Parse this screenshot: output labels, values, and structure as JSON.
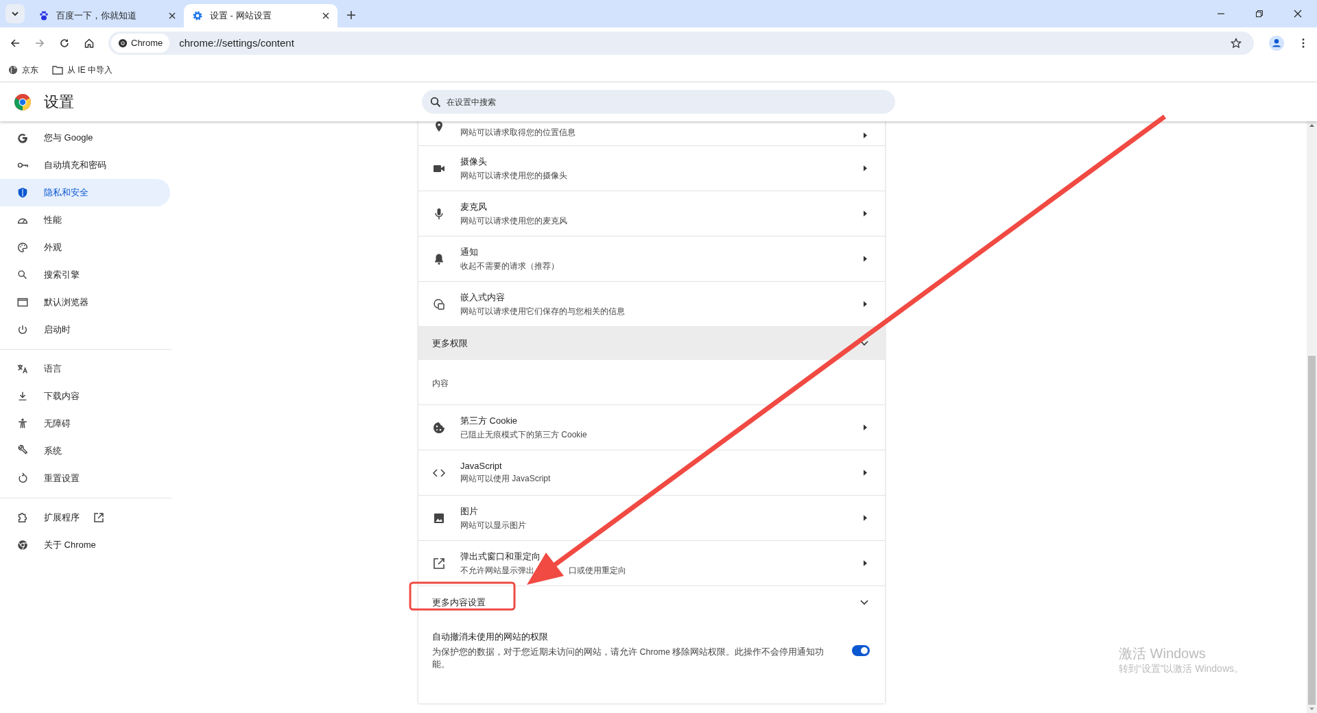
{
  "tabs": [
    {
      "title": "百度一下，你就知道",
      "kind": "paw",
      "selected": false
    },
    {
      "title": "设置 - 网站设置",
      "kind": "gear",
      "selected": true
    }
  ],
  "address_bar": {
    "chip": "Chrome",
    "url": "chrome://settings/content"
  },
  "bookmarks": [
    {
      "label": "京东",
      "kind": "globe"
    },
    {
      "label": "从 IE 中导入",
      "kind": "folder"
    }
  ],
  "header": {
    "title": "设置",
    "search_placeholder": "在设置中搜索"
  },
  "sidebar": {
    "groups": [
      [
        {
          "label": "您与 Google",
          "kind": "google",
          "selected": false,
          "external": false
        },
        {
          "label": "自动填充和密码",
          "kind": "key",
          "selected": false,
          "external": false
        },
        {
          "label": "隐私和安全",
          "kind": "shield",
          "selected": true,
          "external": false
        },
        {
          "label": "性能",
          "kind": "gauge",
          "selected": false,
          "external": false
        },
        {
          "label": "外观",
          "kind": "palette",
          "selected": false,
          "external": false
        },
        {
          "label": "搜索引擎",
          "kind": "search",
          "selected": false,
          "external": false
        },
        {
          "label": "默认浏览器",
          "kind": "window",
          "selected": false,
          "external": false
        },
        {
          "label": "启动时",
          "kind": "power",
          "selected": false,
          "external": false
        }
      ],
      [
        {
          "label": "语言",
          "kind": "translate",
          "selected": false,
          "external": false
        },
        {
          "label": "下载内容",
          "kind": "download",
          "selected": false,
          "external": false
        },
        {
          "label": "无障碍",
          "kind": "person",
          "selected": false,
          "external": false
        },
        {
          "label": "系统",
          "kind": "wrench",
          "selected": false,
          "external": false
        },
        {
          "label": "重置设置",
          "kind": "reset",
          "selected": false,
          "external": false
        }
      ],
      [
        {
          "label": "扩展程序",
          "kind": "puzzle",
          "selected": false,
          "external": true
        },
        {
          "label": "关于 Chrome",
          "kind": "chrome",
          "selected": false,
          "external": false
        }
      ]
    ]
  },
  "content": [
    {
      "kind": "row",
      "subtitle": "网站可以请求取得您的位置信息"
    },
    {
      "kind": "row",
      "title": "摄像头",
      "subtitle": "网站可以请求使用您的摄像头"
    },
    {
      "kind": "row",
      "title": "麦克风",
      "subtitle": "网站可以请求使用您的麦克风"
    },
    {
      "kind": "row",
      "title": "通知",
      "subtitle": "收起不需要的请求（推荐）"
    },
    {
      "kind": "row",
      "title": "嵌入式内容",
      "subtitle": "网站可以请求使用它们保存的与您相关的信息"
    },
    {
      "kind": "collapsible",
      "label": "更多权限",
      "shaded": true
    },
    {
      "kind": "heading",
      "label": "内容"
    },
    {
      "kind": "row",
      "title": "第三方 Cookie",
      "subtitle": "已阻止无痕模式下的第三方 Cookie"
    },
    {
      "kind": "row",
      "title": "JavaScript",
      "subtitle": "网站可以使用 JavaScript"
    },
    {
      "kind": "row",
      "title": "图片",
      "subtitle": "网站可以显示图片"
    },
    {
      "kind": "row",
      "title": "弹出式窗口和重定向",
      "subtitle": "不允许网站显示弹出",
      "subtitle_after": "口或使用重定向"
    },
    {
      "kind": "collapsible",
      "label": "更多内容设置",
      "shaded": false
    },
    {
      "kind": "toggle",
      "title": "自动撤消未使用的网站的权限",
      "description": "为保护您的数据，对于您近期未访问的网站，请允许 Chrome 移除网站权限。此操作不会停用通知功能。",
      "on": true
    }
  ],
  "watermark": {
    "title": "激活 Windows",
    "subtitle": "转到“设置”以激活 Windows。"
  }
}
